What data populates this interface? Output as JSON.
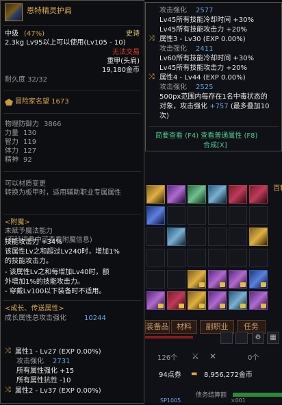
{
  "tooltip": {
    "item_name": "恩特精灵护肩",
    "grade_label": "中级",
    "grade_pct": "(47%)",
    "rarity": "史诗",
    "weight_req": "2.3kg  Lv95以上可以使用(Lv105 - 10)",
    "trade_status": "无法交易",
    "armor_type": "重甲(头肩)",
    "price": "19,180金币",
    "durability": "耐久度  32/32",
    "adventurer_fame_icon": "fame-emblem-icon",
    "adventurer_fame": "冒险家名望 1673",
    "stats": [
      {
        "label": "物理防御力",
        "value": "3866"
      },
      {
        "label": "力量",
        "value": "130"
      },
      {
        "label": "智力",
        "value": "119"
      },
      {
        "label": "体力",
        "value": "127"
      },
      {
        "label": "精神",
        "value": "92"
      }
    ],
    "material_change": "可以材质变更",
    "convert_note": "转换为板甲时，适用辅助职业专属属性",
    "enchant_header": "<附魔>",
    "enchant_none": "未赋予魔法能力",
    "enchant_hint": "(百科词典中可查看附魔信息)",
    "skill_lines": [
      "技能攻击力 +34%",
      "该属性Lv之和超过Lv240时，增加1%",
      "的技能攻击力。",
      "- 该属性Lv之和每增加Lv40时，额",
      "外增加1%的技能攻击力。",
      "- 穿戴Lv100以下装备时不适用。"
    ],
    "growth_header": "<成长、传送属性>",
    "growth_total_label": "成长属性总攻击强化",
    "growth_total_value": "10244",
    "attr1_title": "属性1 - Lv27 (EXP 0.00%)",
    "attr1_atk_label": "攻击强化",
    "attr1_atk_value": "2731",
    "attr1_lines": [
      "所有属性强化 +15",
      "所有属性抗性 -10"
    ],
    "attr2_title": "属性2 - Lv37 (EXP 0.00%)"
  },
  "tooltip2": {
    "atk1_label": "攻击强化",
    "atk1_value": "2577",
    "lines_a": [
      "Lv45所有技能冷却时间 +30%",
      "Lv45所有技能攻击力 +20%"
    ],
    "attr3_title": "属性3 - Lv30 (EXP 0.00%)",
    "atk2_label": "攻击强化",
    "atk2_value": "2411",
    "lines_b": [
      "Lv60所有技能冷却时间 +30%",
      "Lv45所有技能攻击力 +20%"
    ],
    "attr4_title": "属性4 - Lv44 (EXP 0.00%)",
    "atk3_label": "攻击强化",
    "atk3_value": "2525",
    "effect_lines_prefix": [
      "500px范围内每存在1名中毒状态的",
      "对象，攻击强化 "
    ],
    "effect_plus": "+757",
    "effect_max": "(最多叠加10",
    "effect_tail": "次)",
    "view_simple": "简要查看 (F4) 查看普通属性 (F8)",
    "synthesis": "合成[X]"
  },
  "inventory": {
    "tabs": [
      "装备品",
      "材料",
      "副职业",
      "任务"
    ],
    "tab_icon_right": "百科",
    "count_label": "126个",
    "count_label2": "0个",
    "points_label": "94点券",
    "gold_label": "8,956,272金币",
    "sp_label": "SP1005",
    "debt_label": "债务结算额",
    "x_label": "×001"
  },
  "colors": {
    "gold_accent": "#d6a64a",
    "epic": "#f0d27a",
    "stat_blue": "#6aa6e6",
    "growth_green": "#4ec98c",
    "warn_red": "#e03a2a"
  }
}
